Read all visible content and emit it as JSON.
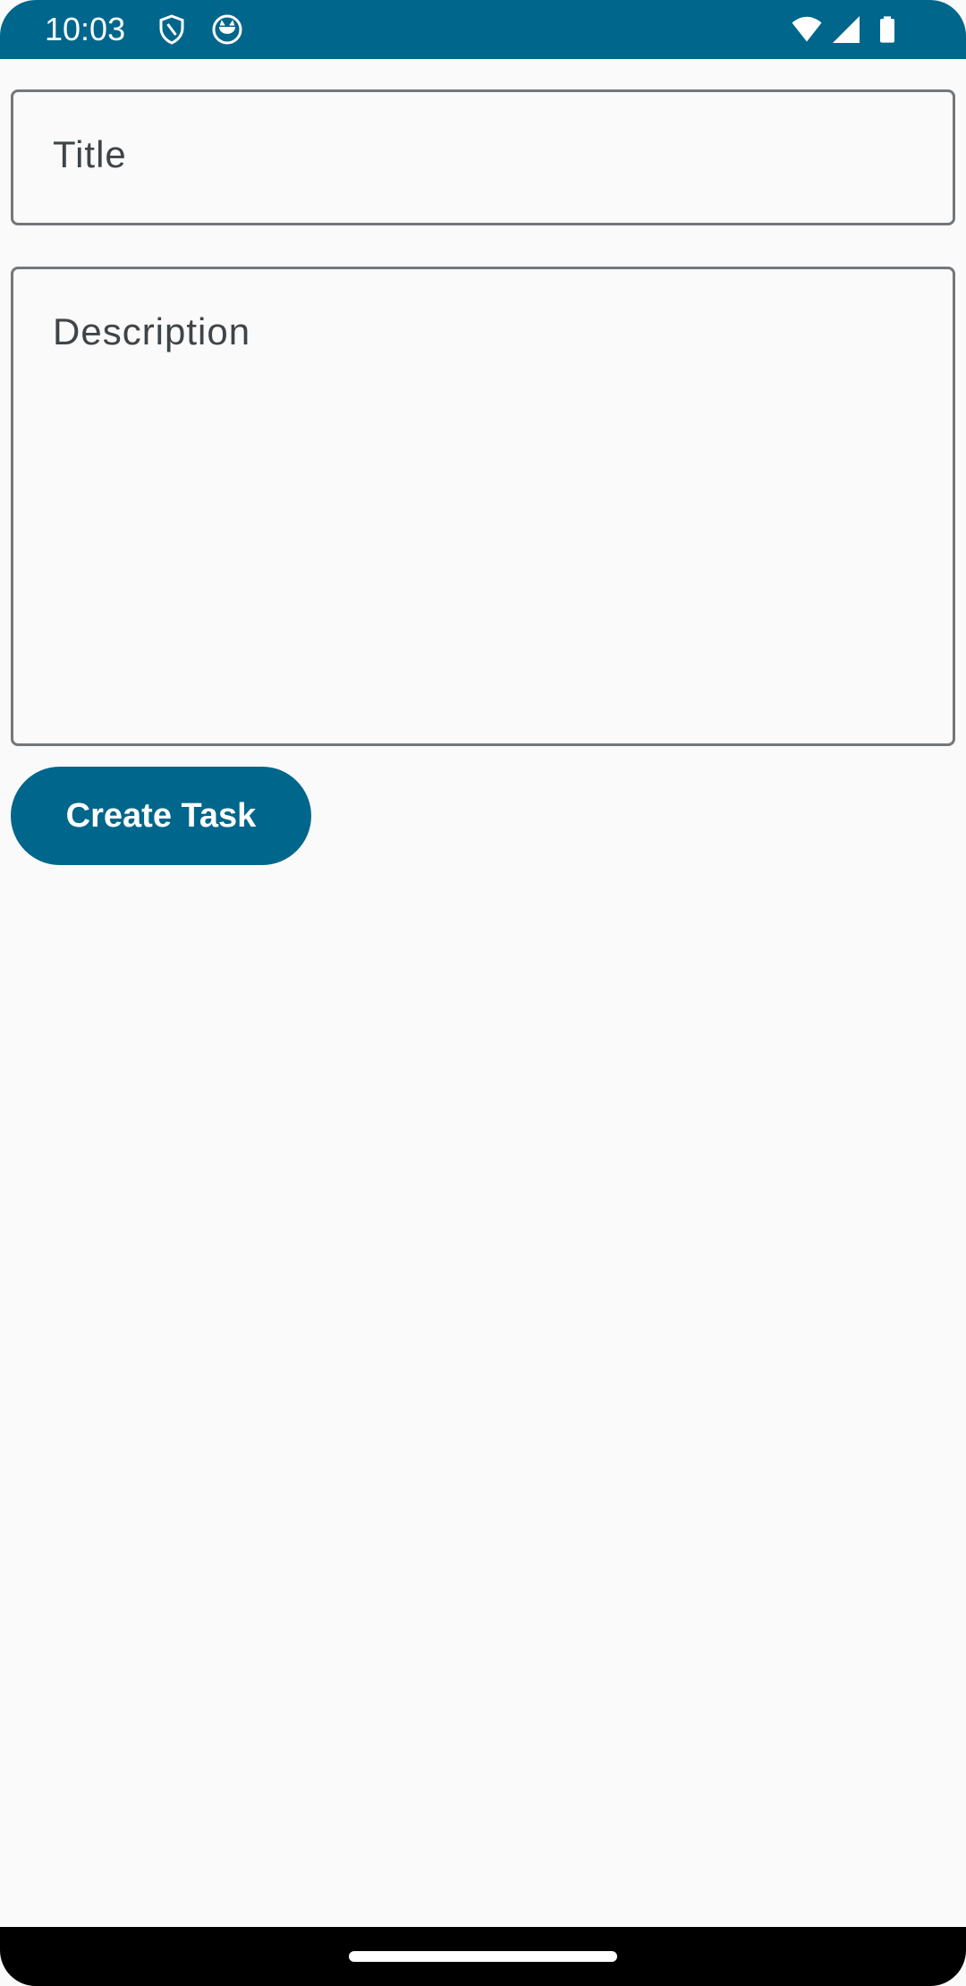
{
  "status_bar": {
    "time": "10:03",
    "icons": [
      "shield-icon",
      "cat-face-icon",
      "wifi-icon",
      "cellular-signal-icon",
      "battery-icon"
    ],
    "background_color": "#00668c"
  },
  "form": {
    "title_placeholder": "Title",
    "description_placeholder": "Description"
  },
  "actions": {
    "create_label": "Create Task",
    "accent_color": "#00668c"
  }
}
